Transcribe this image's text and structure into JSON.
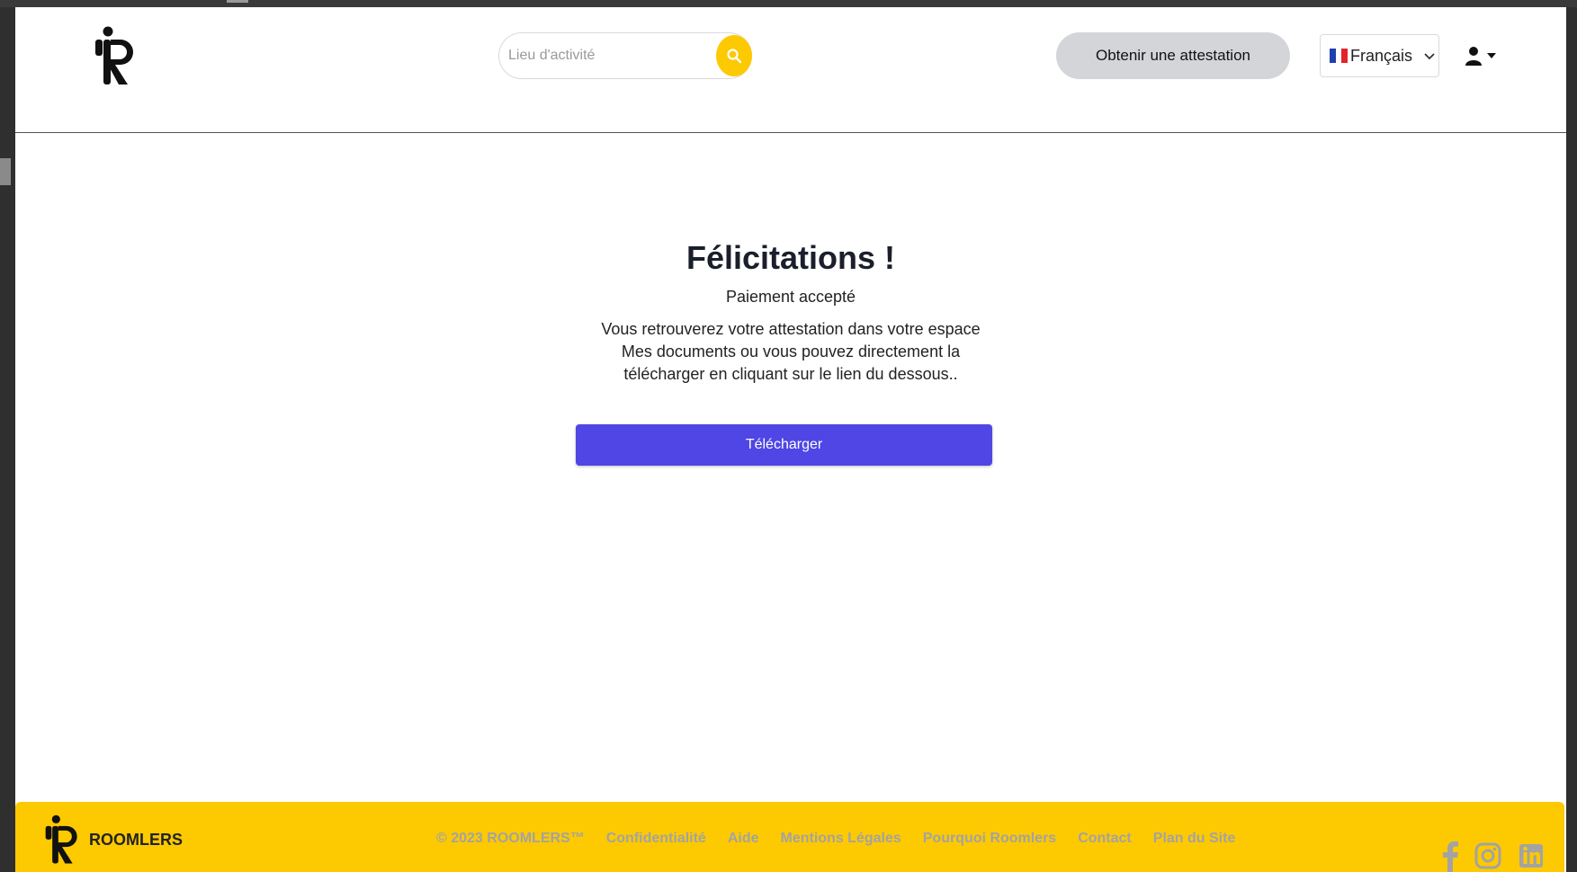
{
  "header": {
    "search": {
      "placeholder": "Lieu d'activité"
    },
    "attest_button": "Obtenir une attestation",
    "language": {
      "selected": "Français",
      "flag": "flag-fr-icon"
    }
  },
  "main": {
    "title": "Félicitations !",
    "subtitle": "Paiement accepté",
    "message": "Vous retrouverez votre attestation dans votre espace Mes documents ou vous pouvez directement la télécharger en cliquant sur le lien du dessous..",
    "download_button": "Télécharger"
  },
  "footer": {
    "brand": "ROOMLERS",
    "copyright": "© 2023 ROOMLERS™",
    "links": [
      "Confidentialité",
      "Aide",
      "Mentions Légales",
      "Pourquoi Roomlers",
      "Contact",
      "Plan du Site"
    ],
    "social": [
      "facebook-icon",
      "instagram-icon",
      "linkedin-icon"
    ]
  },
  "colors": {
    "accent_yellow": "#fdc900",
    "primary_button": "#4f46e5",
    "attest_button_bg": "#d3d5d9",
    "footer_link": "#a3a3a3"
  }
}
